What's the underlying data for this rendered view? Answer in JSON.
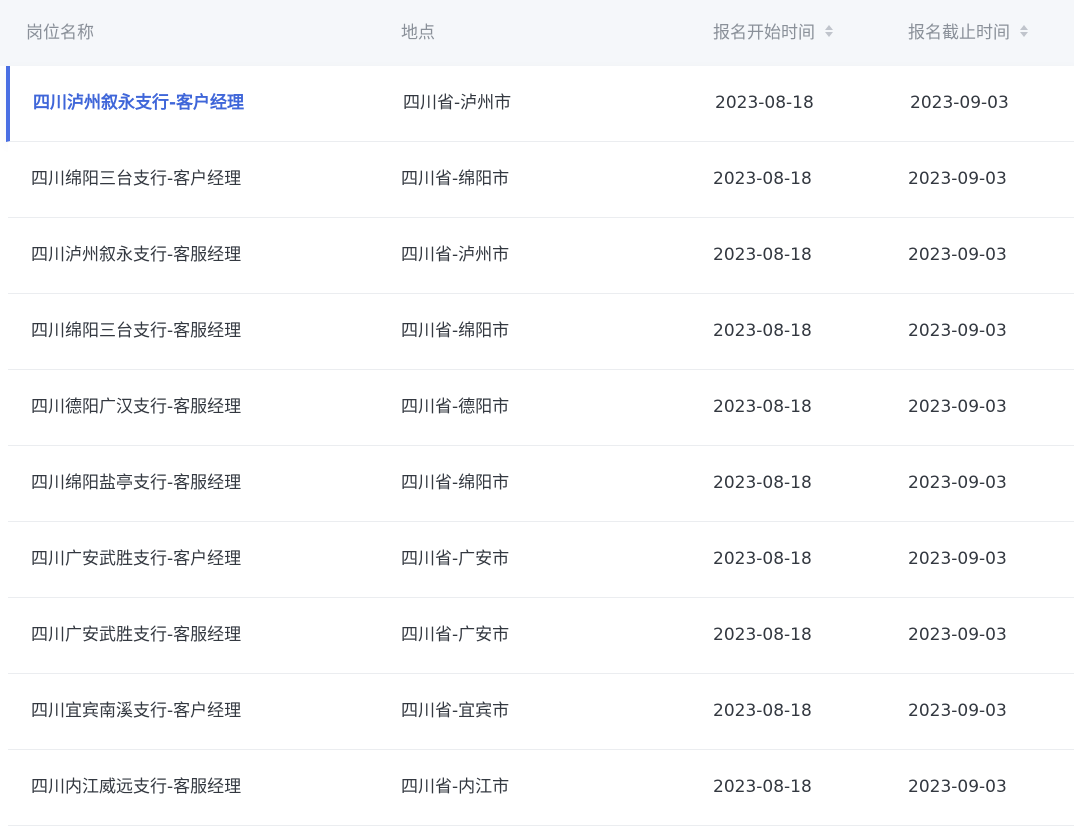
{
  "table": {
    "columns": [
      {
        "label": "岗位名称",
        "sortable": false
      },
      {
        "label": "地点",
        "sortable": false
      },
      {
        "label": "报名开始时间",
        "sortable": true
      },
      {
        "label": "报名截止时间",
        "sortable": true
      }
    ],
    "active_row_index": 0,
    "colors": {
      "accent": "#4a6fe3",
      "header_bg": "#f5f7fa",
      "header_text": "#8a9099",
      "row_text": "#333840",
      "divider": "#ebedf0"
    },
    "rows": [
      {
        "name": "四川泸州叙永支行-客户经理",
        "location": "四川省-泸州市",
        "start": "2023-08-18",
        "end": "2023-09-03"
      },
      {
        "name": "四川绵阳三台支行-客户经理",
        "location": "四川省-绵阳市",
        "start": "2023-08-18",
        "end": "2023-09-03"
      },
      {
        "name": "四川泸州叙永支行-客服经理",
        "location": "四川省-泸州市",
        "start": "2023-08-18",
        "end": "2023-09-03"
      },
      {
        "name": "四川绵阳三台支行-客服经理",
        "location": "四川省-绵阳市",
        "start": "2023-08-18",
        "end": "2023-09-03"
      },
      {
        "name": "四川德阳广汉支行-客服经理",
        "location": "四川省-德阳市",
        "start": "2023-08-18",
        "end": "2023-09-03"
      },
      {
        "name": "四川绵阳盐亭支行-客服经理",
        "location": "四川省-绵阳市",
        "start": "2023-08-18",
        "end": "2023-09-03"
      },
      {
        "name": "四川广安武胜支行-客户经理",
        "location": "四川省-广安市",
        "start": "2023-08-18",
        "end": "2023-09-03"
      },
      {
        "name": "四川广安武胜支行-客服经理",
        "location": "四川省-广安市",
        "start": "2023-08-18",
        "end": "2023-09-03"
      },
      {
        "name": "四川宜宾南溪支行-客户经理",
        "location": "四川省-宜宾市",
        "start": "2023-08-18",
        "end": "2023-09-03"
      },
      {
        "name": "四川内江威远支行-客服经理",
        "location": "四川省-内江市",
        "start": "2023-08-18",
        "end": "2023-09-03"
      }
    ]
  }
}
